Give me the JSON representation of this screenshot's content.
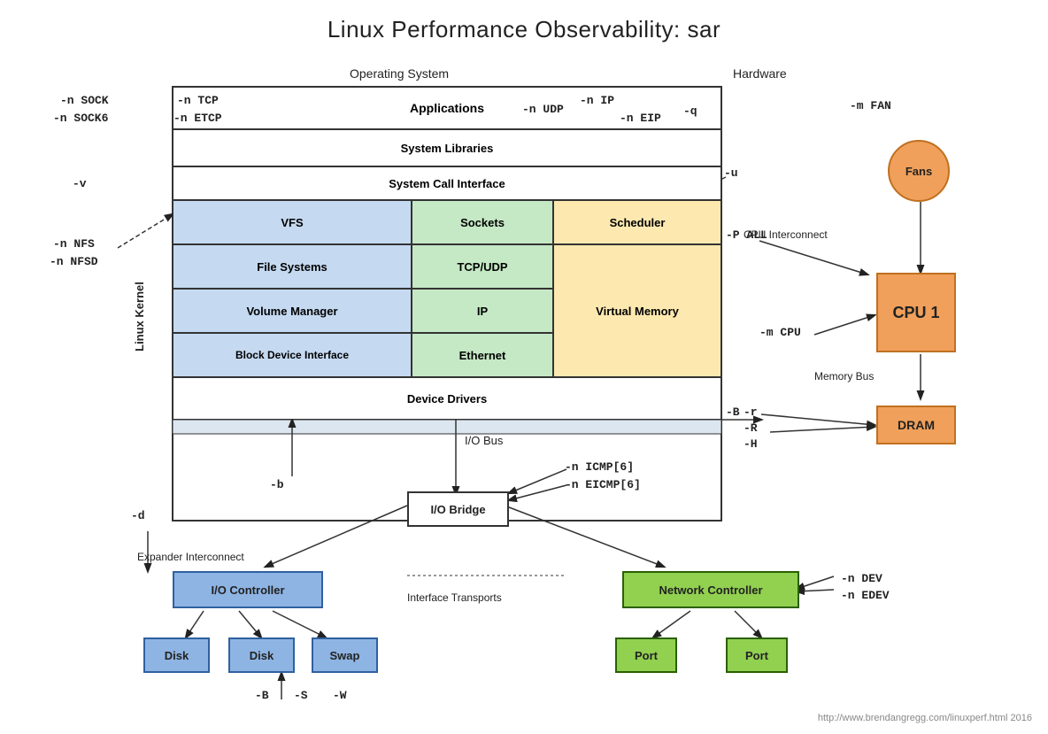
{
  "title": "Linux Performance Observability: sar",
  "labels": {
    "operating_system": "Operating System",
    "hardware": "Hardware",
    "applications": "Applications",
    "system_libraries": "System Libraries",
    "syscall_interface": "System Call Interface",
    "vfs": "VFS",
    "file_systems": "File Systems",
    "volume_manager": "Volume Manager",
    "block_device": "Block Device Interface",
    "device_drivers": "Device Drivers",
    "sockets": "Sockets",
    "tcp_udp": "TCP/UDP",
    "ip": "IP",
    "ethernet": "Ethernet",
    "scheduler": "Scheduler",
    "virtual_memory": "Virtual Memory",
    "linux_kernel": "Linux Kernel",
    "fans": "Fans",
    "cpu1": "CPU\n1",
    "dram": "DRAM",
    "io_bus": "I/O Bus",
    "io_bridge": "I/O Bridge",
    "expander_interconnect": "Expander Interconnect",
    "io_controller": "I/O Controller",
    "disk1": "Disk",
    "disk2": "Disk",
    "swap": "Swap",
    "interface_transports": "Interface Transports",
    "network_controller": "Network Controller",
    "port1": "Port",
    "port2": "Port",
    "cpu_interconnect": "CPU\nInterconnect",
    "memory_bus": "Memory\nBus"
  },
  "sar_commands": {
    "n_sock": "-n SOCK",
    "n_sock6": "-n SOCK6",
    "n_tcp": "-n TCP",
    "n_etcp": "-n ETCP",
    "n_ip": "-n IP",
    "n_eip": "-n EIP",
    "n_udp": "-n UDP",
    "v": "-v",
    "q": "-q",
    "u": "-u",
    "p_all": "-P ALL",
    "n_nfs": "-n NFS",
    "n_nfsd": "-n NFSD",
    "m_fan": "-m FAN",
    "m_cpu": "-m CPU",
    "r": "-r",
    "big_r": "-R",
    "big_h": "-H",
    "big_b": "-B",
    "b": "-b",
    "d": "-d",
    "n_icmp": "-n ICMP[6]",
    "n_eicmp": "-n EICMP[6]",
    "n_dev": "-n DEV",
    "n_edev": "-n EDEV",
    "big_b2": "-B",
    "big_s": "-S",
    "big_w": "-W"
  },
  "footer": "http://www.brendangregg.com/linuxperf.html 2016"
}
